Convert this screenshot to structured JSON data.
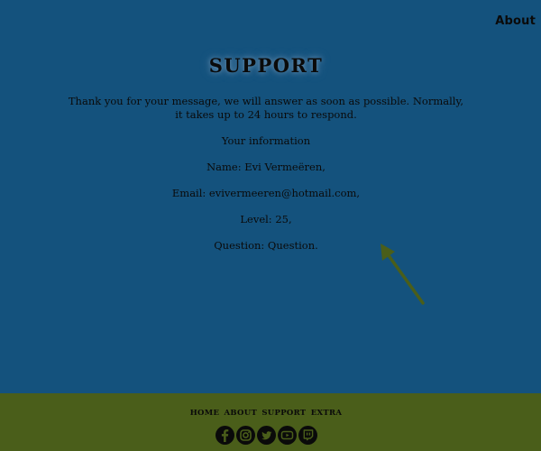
{
  "top_nav": {
    "about_label": "About"
  },
  "page": {
    "title": "SUPPORT",
    "confirmation": "Thank you for your message, we will answer as soon as possible. Normally, it takes up to 24 hours to respond."
  },
  "info": {
    "heading": "Your information",
    "name": "Name: Evi Vermeëren,",
    "email": "Email: evivermeeren@hotmail.com,",
    "level": "Level: 25,",
    "question": "Question: Question."
  },
  "footer": {
    "nav": [
      {
        "label": "HOME"
      },
      {
        "label": "ABOUT"
      },
      {
        "label": "SUPPORT"
      },
      {
        "label": "EXTRA"
      }
    ],
    "social": [
      {
        "icon": "facebook-icon"
      },
      {
        "icon": "instagram-icon"
      },
      {
        "icon": "twitter-icon"
      },
      {
        "icon": "youtube-icon"
      },
      {
        "icon": "twitch-icon"
      }
    ]
  },
  "colors": {
    "page_background": "#14527d",
    "footer_background": "#4a5e1a",
    "arrow": "#4a5e1a",
    "text": "#0a0a0a"
  }
}
